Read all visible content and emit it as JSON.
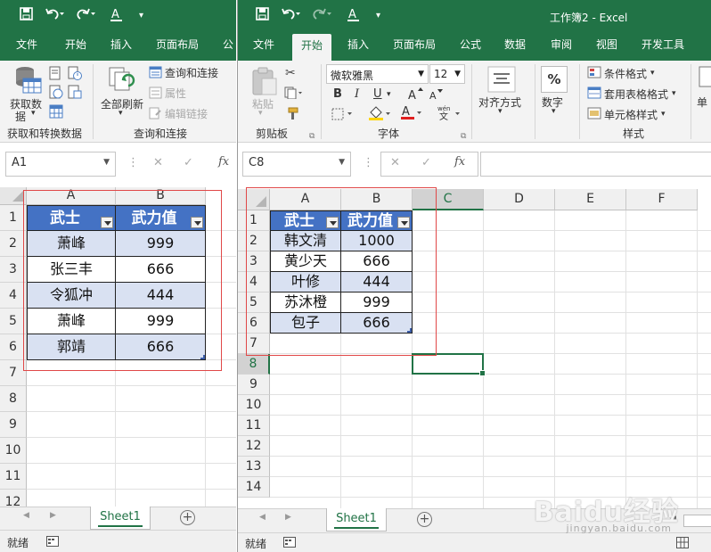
{
  "left_window": {
    "ribbon_tabs": [
      "文件",
      "开始",
      "插入",
      "页面布局",
      "公"
    ],
    "get_data": {
      "line1": "获取数",
      "line2": "据"
    },
    "refresh_all": "全部刷新",
    "queries_connections": "查询和连接",
    "properties": "属性",
    "edit_links": "编辑链接",
    "group_get_transform": "获取和转换数据",
    "group_queries": "查询和连接",
    "name_box": "A1",
    "columns": [
      "A",
      "B"
    ],
    "rows": [
      "1",
      "2",
      "3",
      "4",
      "5",
      "6",
      "7",
      "8",
      "9",
      "10",
      "11",
      "12"
    ],
    "table": {
      "headers": [
        "武士",
        "武力值"
      ],
      "rows": [
        [
          "萧峰",
          "999"
        ],
        [
          "张三丰",
          "666"
        ],
        [
          "令狐冲",
          "444"
        ],
        [
          "萧峰",
          "999"
        ],
        [
          "郭靖",
          "666"
        ]
      ]
    },
    "sheet_tab": "Sheet1",
    "status": "就绪"
  },
  "right_window": {
    "title": "工作簿2  -  Excel",
    "ribbon_tabs": [
      "文件",
      "开始",
      "插入",
      "页面布局",
      "公式",
      "数据",
      "审阅",
      "视图",
      "开发工具"
    ],
    "active_tab": "开始",
    "clipboard": {
      "paste": "粘贴",
      "group": "剪贴板"
    },
    "font": {
      "name": "微软雅黑",
      "size": "12",
      "group": "字体",
      "bold": "B",
      "italic": "I",
      "underline": "U"
    },
    "alignment": {
      "label": "对齐方式"
    },
    "number": {
      "label": "数字",
      "icon": "%"
    },
    "styles": {
      "conditional": "条件格式",
      "table_format": "套用表格格式",
      "cell_styles": "单元格样式",
      "group": "样式"
    },
    "cells_group": "单",
    "name_box": "C8",
    "columns": [
      "A",
      "B",
      "C",
      "D",
      "E",
      "F"
    ],
    "rows": [
      "1",
      "2",
      "3",
      "4",
      "5",
      "6",
      "7",
      "8",
      "9",
      "10",
      "11",
      "12",
      "13",
      "14"
    ],
    "table": {
      "headers": [
        "武士",
        "武力值"
      ],
      "rows": [
        [
          "韩文清",
          "1000"
        ],
        [
          "黄少天",
          "666"
        ],
        [
          "叶修",
          "444"
        ],
        [
          "苏沐橙",
          "999"
        ],
        [
          "包子",
          "666"
        ]
      ]
    },
    "sheet_tab": "Sheet1",
    "status": "就绪"
  },
  "watermark": {
    "brand": "Baidu经验",
    "url": "jingyan.baidu.com"
  },
  "colors": {
    "excel_green": "#217346",
    "table_header": "#4472c4",
    "band": "#d9e1f2",
    "annotation_red": "#e04848"
  }
}
